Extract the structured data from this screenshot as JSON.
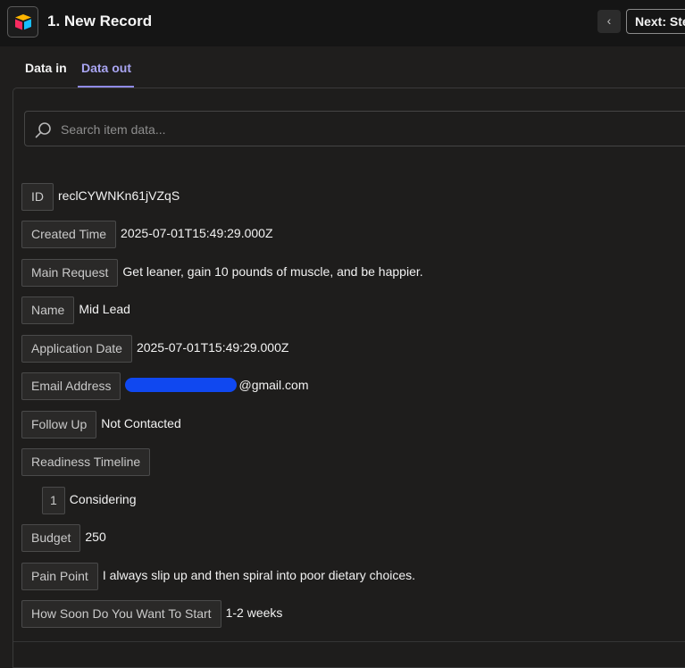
{
  "header": {
    "title": "1. New Record",
    "app_icon": "airtable-logo-icon",
    "back_icon": "chevron-left-icon",
    "next_label": "Next: Ste"
  },
  "tabs": [
    {
      "label": "Data in",
      "active": false
    },
    {
      "label": "Data out",
      "active": true
    }
  ],
  "search": {
    "placeholder": "Search item data...",
    "icon": "search-icon"
  },
  "fields": [
    {
      "key": "ID",
      "value": "reclCYWNKn61jVZqS"
    },
    {
      "key": "Created Time",
      "value": "2025-07-01T15:49:29.000Z"
    },
    {
      "key": "Main Request",
      "value": "Get leaner, gain 10 pounds of muscle, and be happier."
    },
    {
      "key": "Name",
      "value": "Mid Lead"
    },
    {
      "key": "Application Date",
      "value": "2025-07-01T15:49:29.000Z"
    },
    {
      "key": "Email Address",
      "value": "@gmail.com",
      "redacted": true
    },
    {
      "key": "Follow Up",
      "value": "Not Contacted"
    },
    {
      "key": "Readiness Timeline",
      "value": ""
    },
    {
      "key": "1",
      "value": "Considering"
    },
    {
      "key": "Budget",
      "value": "250"
    },
    {
      "key": "Pain Point",
      "value": "I always slip up and then spiral into poor dietary choices."
    },
    {
      "key": "How Soon Do You Want To Start",
      "value": "1-2 weeks"
    }
  ],
  "colors": {
    "accent": "#a9a5f2",
    "background": "#1f1e1d",
    "header_bg": "#151515",
    "redaction": "#1048f0"
  }
}
